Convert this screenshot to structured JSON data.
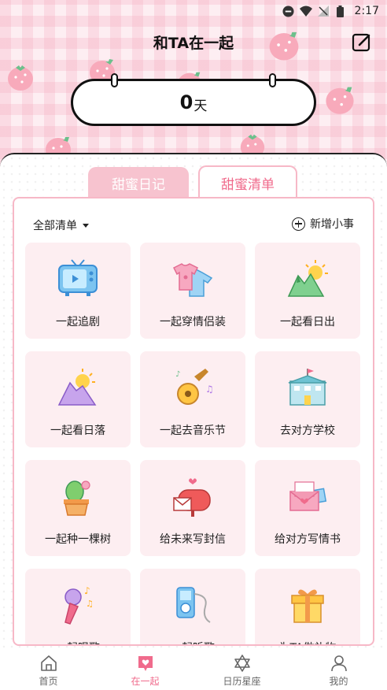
{
  "status_bar": {
    "time": "2:17"
  },
  "header": {
    "title": "和TA在一起"
  },
  "counter": {
    "value": "0",
    "unit": "天"
  },
  "tabs": [
    {
      "label": "甜蜜日记",
      "active": false
    },
    {
      "label": "甜蜜清单",
      "active": true
    }
  ],
  "list": {
    "filter_label": "全部清单",
    "add_label": "新增小事",
    "items": [
      {
        "label": "一起追剧",
        "icon": "tv-icon"
      },
      {
        "label": "一起穿情侣装",
        "icon": "couple-shirts-icon"
      },
      {
        "label": "一起看日出",
        "icon": "sunrise-icon"
      },
      {
        "label": "一起看日落",
        "icon": "sunset-icon"
      },
      {
        "label": "一起去音乐节",
        "icon": "guitar-icon"
      },
      {
        "label": "去对方学校",
        "icon": "school-icon"
      },
      {
        "label": "一起种一棵树",
        "icon": "potted-plant-icon"
      },
      {
        "label": "给未来写封信",
        "icon": "mailbox-icon"
      },
      {
        "label": "给对方写情书",
        "icon": "love-letter-icon"
      },
      {
        "label": "一起唱歌",
        "icon": "microphone-icon"
      },
      {
        "label": "一起听歌",
        "icon": "music-player-icon"
      },
      {
        "label": "为TA做礼物",
        "icon": "gift-icon"
      }
    ]
  },
  "bottom_nav": [
    {
      "label": "首页",
      "icon": "home-icon",
      "active": false
    },
    {
      "label": "在一起",
      "icon": "heart-chat-icon",
      "active": true
    },
    {
      "label": "日历星座",
      "icon": "star-of-david-icon",
      "active": false
    },
    {
      "label": "我的",
      "icon": "person-icon",
      "active": false
    }
  ],
  "colors": {
    "accent": "#f06b8c",
    "tab_inactive": "#f7c3cf",
    "tile_bg": "#fdeef1"
  }
}
